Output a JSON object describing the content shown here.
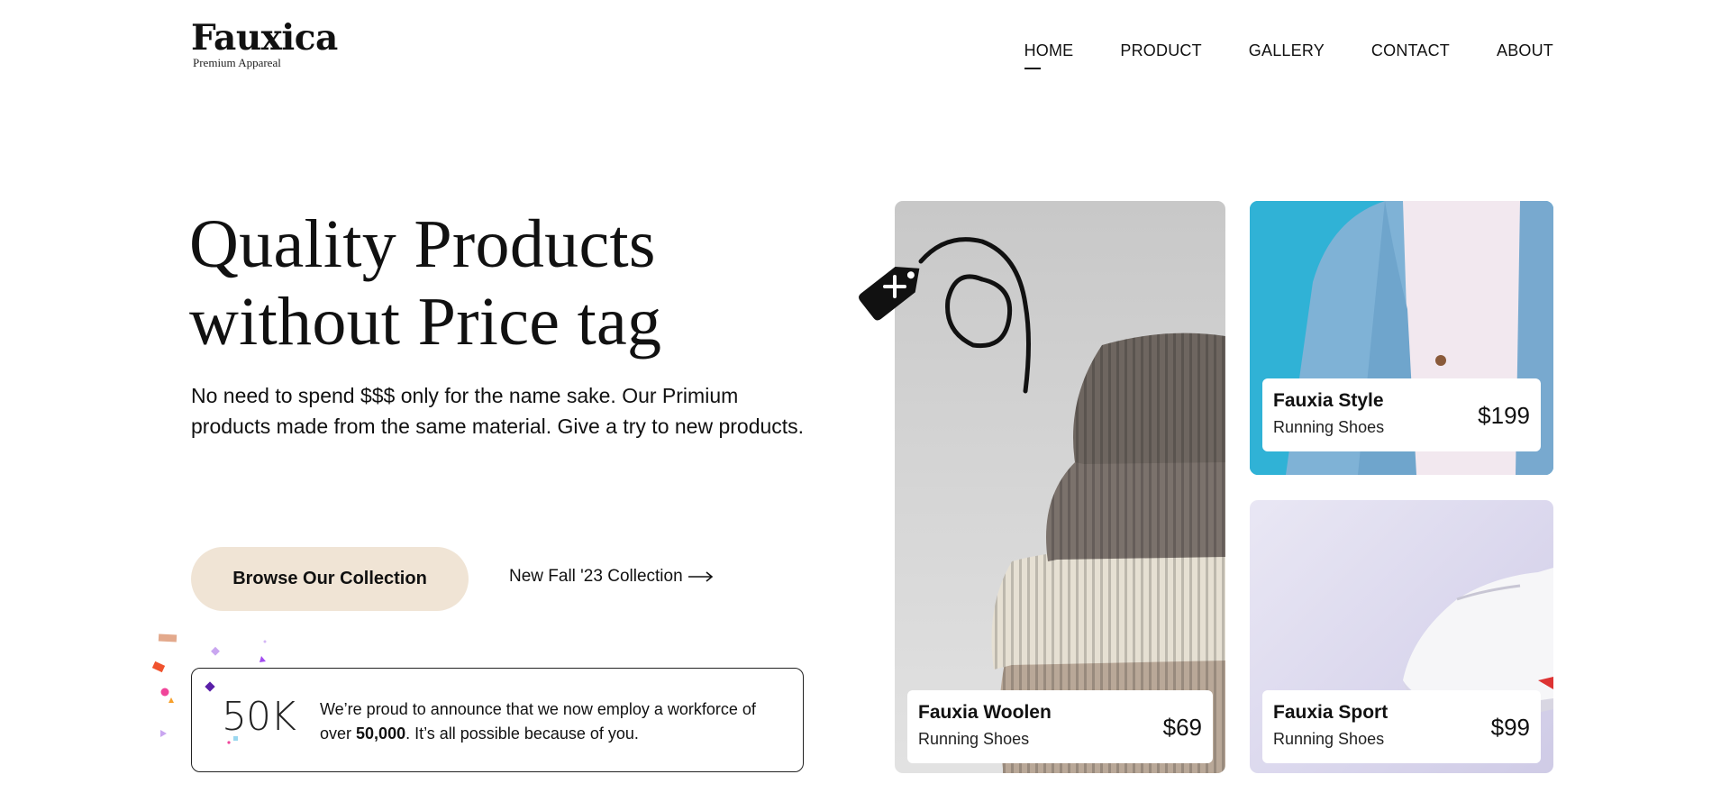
{
  "brand": {
    "name": "Fauxica",
    "tagline": "Premium Appareal"
  },
  "nav": {
    "items": [
      {
        "label": "HOME",
        "active": true
      },
      {
        "label": "PRODUCT",
        "active": false
      },
      {
        "label": "GALLERY",
        "active": false
      },
      {
        "label": "CONTACT",
        "active": false
      },
      {
        "label": "ABOUT",
        "active": false
      }
    ]
  },
  "hero": {
    "title_line1": "Quality Products",
    "title_line2": "without Price tag",
    "description": "No need to spend $$$ only for the name sake. Our Primium products made from the same material. Give a try to new products.",
    "browse_label": "Browse Our Collection",
    "fall_link_label": "New Fall '23 Collection"
  },
  "stats": {
    "number": "50K",
    "text_before": "We’re proud to announce that we now employ a workforce of over ",
    "text_bold": "50,000",
    "text_after": ". It’s all possible because of you."
  },
  "products": [
    {
      "name": "Fauxia Woolen",
      "sub": "Running Shoes",
      "price": "$69"
    },
    {
      "name": "Fauxia Style",
      "sub": "Running Shoes",
      "price": "$199"
    },
    {
      "name": "Fauxia Sport",
      "sub": "Running Shoes",
      "price": "$99"
    }
  ],
  "icons": {
    "price_tag": "price-tag-icon",
    "arrow": "arrow-right-icon"
  },
  "colors": {
    "browse_button_bg": "#f0e4d5",
    "style_card_bg": "#30b2d6",
    "sport_card_bg": "#dcd9ee"
  }
}
